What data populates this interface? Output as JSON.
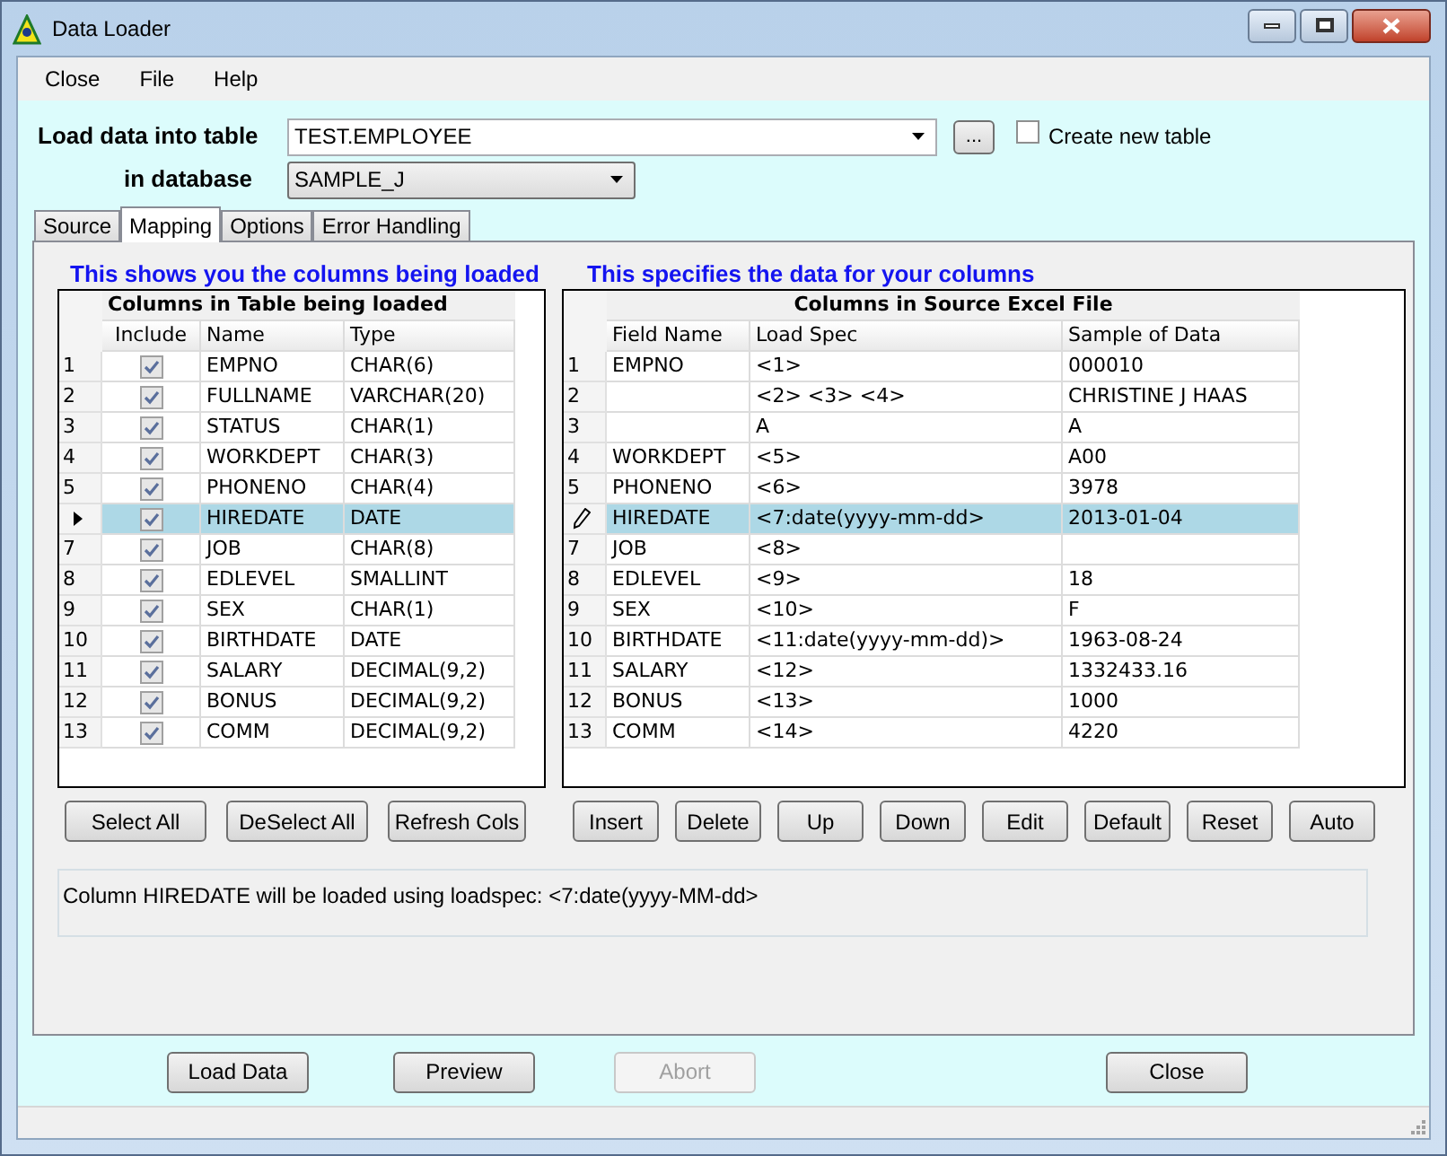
{
  "window": {
    "title": "Data Loader"
  },
  "menu": [
    "Close",
    "File",
    "Help"
  ],
  "table_row": {
    "label": "Load data into table",
    "value": "TEST.EMPLOYEE",
    "browse": "...",
    "create_new": {
      "label": "Create new table",
      "checked": false
    }
  },
  "database_row": {
    "label": "in database",
    "value": "SAMPLE_J"
  },
  "tabs": [
    {
      "label": "Source",
      "selected": false
    },
    {
      "label": "Mapping",
      "selected": true
    },
    {
      "label": "Options",
      "selected": false
    },
    {
      "label": "Error Handling",
      "selected": false
    }
  ],
  "left": {
    "heading": "This shows you the columns being loaded",
    "title": "Columns in Table being loaded",
    "columns": [
      "Include",
      "Name",
      "Type"
    ],
    "rows": [
      {
        "number": "1",
        "include": true,
        "name": "EMPNO",
        "type": "CHAR(6)",
        "selected": false
      },
      {
        "number": "2",
        "include": true,
        "name": "FULLNAME",
        "type": "VARCHAR(20)",
        "selected": false
      },
      {
        "number": "3",
        "include": true,
        "name": "STATUS",
        "type": "CHAR(1)",
        "selected": false
      },
      {
        "number": "4",
        "include": true,
        "name": "WORKDEPT",
        "type": "CHAR(3)",
        "selected": false
      },
      {
        "number": "5",
        "include": true,
        "name": "PHONENO",
        "type": "CHAR(4)",
        "selected": false
      },
      {
        "include": true,
        "name": "HIREDATE",
        "type": "DATE",
        "selected": true
      },
      {
        "number": "7",
        "include": true,
        "name": "JOB",
        "type": "CHAR(8)",
        "selected": false
      },
      {
        "number": "8",
        "include": true,
        "name": "EDLEVEL",
        "type": "SMALLINT",
        "selected": false
      },
      {
        "number": "9",
        "include": true,
        "name": "SEX",
        "type": "CHAR(1)",
        "selected": false
      },
      {
        "number": "10",
        "include": true,
        "name": "BIRTHDATE",
        "type": "DATE",
        "selected": false
      },
      {
        "number": "11",
        "include": true,
        "name": "SALARY",
        "type": "DECIMAL(9,2)",
        "selected": false
      },
      {
        "number": "12",
        "include": true,
        "name": "BONUS",
        "type": "DECIMAL(9,2)",
        "selected": false
      },
      {
        "number": "13",
        "include": true,
        "name": "COMM",
        "type": "DECIMAL(9,2)",
        "selected": false
      }
    ],
    "buttons": [
      "Select All",
      "DeSelect All",
      "Refresh Cols"
    ]
  },
  "right": {
    "heading": "This specifies the data for your columns",
    "title": "Columns in Source Excel File",
    "columns": [
      "Field Name",
      "Load Spec",
      "Sample of Data"
    ],
    "rows": [
      {
        "number": "1",
        "field": "EMPNO",
        "spec": "<1>",
        "sample": "000010",
        "selected": false
      },
      {
        "number": "2",
        "spec": "<2> <3> <4>",
        "sample": "CHRISTINE J HAAS",
        "selected": false
      },
      {
        "number": "3",
        "spec": "A",
        "sample": "A",
        "selected": false
      },
      {
        "number": "4",
        "field": "WORKDEPT",
        "spec": "<5>",
        "sample": "A00",
        "selected": false
      },
      {
        "number": "5",
        "field": "PHONENO",
        "spec": "<6>",
        "sample": "3978",
        "selected": false
      },
      {
        "field": "HIREDATE",
        "spec": "<7:date(yyyy-mm-dd>",
        "sample": "2013-01-04",
        "selected": true
      },
      {
        "number": "7",
        "field": "JOB",
        "spec": "<8>",
        "selected": false
      },
      {
        "number": "8",
        "field": "EDLEVEL",
        "spec": "<9>",
        "sample": "18",
        "selected": false
      },
      {
        "number": "9",
        "field": "SEX",
        "spec": "<10>",
        "sample": "F",
        "selected": false
      },
      {
        "number": "10",
        "field": "BIRTHDATE",
        "spec": "<11:date(yyyy-mm-dd)>",
        "sample": "1963-08-24",
        "selected": false
      },
      {
        "number": "11",
        "field": "SALARY",
        "spec": "<12>",
        "sample": "1332433.16",
        "selected": false
      },
      {
        "number": "12",
        "field": "BONUS",
        "spec": "<13>",
        "sample": "1000",
        "selected": false
      },
      {
        "number": "13",
        "field": "COMM",
        "spec": "<14>",
        "sample": "4220",
        "selected": false
      }
    ],
    "buttons": [
      "Insert",
      "Delete",
      "Up",
      "Down",
      "Edit",
      "Default",
      "Reset",
      "Auto"
    ]
  },
  "message": "Column HIREDATE will be loaded using loadspec: <7:date(yyyy-MM-dd>",
  "bottom_buttons": [
    {
      "label": "Load Data",
      "disabled": false
    },
    {
      "label": "Preview",
      "disabled": false
    },
    {
      "label": "Abort",
      "disabled": true
    },
    {
      "label": "Close",
      "disabled": false
    }
  ]
}
